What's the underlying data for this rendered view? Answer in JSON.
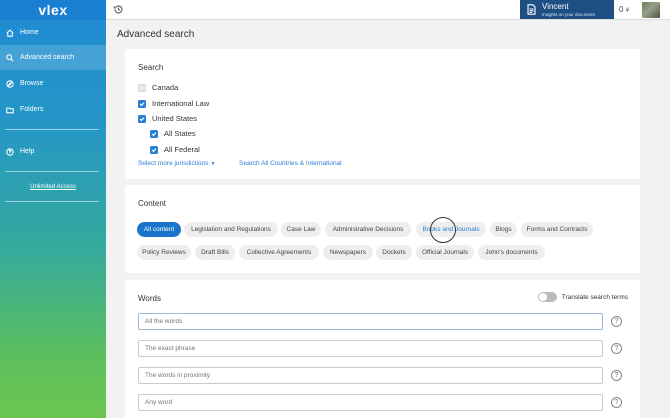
{
  "brand": {
    "logo": "vlex"
  },
  "sidebar": {
    "items": [
      {
        "label": "Home",
        "icon": "home-icon"
      },
      {
        "label": "Advanced search",
        "icon": "search-icon"
      },
      {
        "label": "Browse",
        "icon": "compass-icon"
      },
      {
        "label": "Folders",
        "icon": "folder-icon"
      },
      {
        "label": "Help",
        "icon": "help-circle-icon"
      }
    ],
    "unlimited_access": "Unlimited Access"
  },
  "header": {
    "history_icon": "history-icon",
    "user_name": "Vincent",
    "user_subtitle": "Insights on your document",
    "credits": "0",
    "credits_currency": "¥"
  },
  "page": {
    "title": "Advanced search"
  },
  "search": {
    "title": "Search",
    "jurisdictions": [
      {
        "label": "Canada",
        "checked": false
      },
      {
        "label": "International Law",
        "checked": true
      },
      {
        "label": "United States",
        "checked": true
      },
      {
        "label": "All States",
        "checked": true
      },
      {
        "label": "All Federal",
        "checked": true
      }
    ],
    "select_more": "Select more jurisdictions",
    "search_all": "Search All Countries & International"
  },
  "content": {
    "title": "Content",
    "row1": [
      "All content",
      "Legislation and Regulations",
      "Case Law",
      "Administrative Decisions",
      "Books and Journals",
      "Blogs",
      "Forms and Contracts"
    ],
    "row2": [
      "Policy Reviews",
      "Draft Bills",
      "Collective Agreements",
      "Newspapers",
      "Dockets",
      "Official Journals",
      "John's documents"
    ],
    "active": "All content"
  },
  "words": {
    "title": "Words",
    "translate_label": "Translate search terms",
    "translate_on": false,
    "fields": [
      {
        "placeholder": "All the words"
      },
      {
        "placeholder": "The exact phrase"
      },
      {
        "placeholder": "The words in proximity"
      },
      {
        "placeholder": "Any word"
      }
    ],
    "help_symbol": "?"
  },
  "colors": {
    "accent": "#1a74c9",
    "user_box": "#1d4f84"
  }
}
